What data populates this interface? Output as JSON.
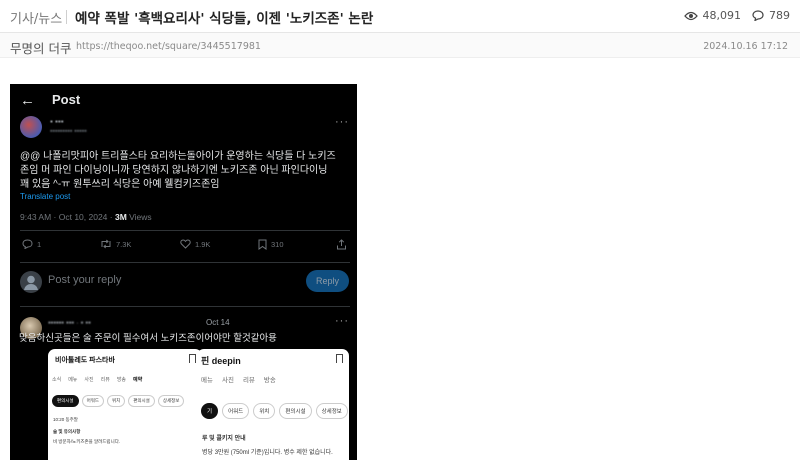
{
  "header": {
    "category": "기사/뉴스",
    "title": "예약 폭발 '흑백요리사' 식당들, 이젠 '노키즈존' 논란",
    "views": "48,091",
    "comments": "789"
  },
  "meta": {
    "author": "무명의 더쿠",
    "url": "https://theqoo.net/square/3445517981",
    "date": "2024.10.16 17:12"
  },
  "embed": {
    "back_label": "←",
    "post_title": "Post",
    "tweet_text_line1": "@@ 나폴리맛피아 트리플스타 요리하는돌아이가 운영하는 식당들 다 노키즈",
    "tweet_text_line2": "존임 머 파인 다이닝이니까 당연하지 않나하기엔 노키즈존 아닌 파인다이닝",
    "tweet_text_line3": "꽤 있음 ^-ㅠ 원투쓰리 식당은 아예 웰컴키즈존임",
    "translate": "Translate post",
    "time": "9:43 AM · Oct 10, 2024 · ",
    "views_count": "3M",
    "views_label": " Views",
    "actions": {
      "replies": "1",
      "reposts": "7.3K",
      "likes": "1.9K",
      "bookmarks": "310"
    },
    "reply_placeholder": "Post your reply",
    "reply_button": "Reply",
    "comment_date": "Oct 14",
    "comment_text": "맞음하신곳들은 술 주문이 필수여서 노키즈존이어야만 할것같아용",
    "phone1": {
      "title": "비아톨레도 파스타바",
      "tabs": [
        "소식",
        "메뉴",
        "사진",
        "리뷰",
        "방송",
        "예약"
      ],
      "chips": [
        "편의시설",
        "어워드",
        "위치",
        "편의시설",
        "상세정보"
      ],
      "line1": "10:20 동주말",
      "line2": "술 및 유의사항",
      "line3": "비 방문자/노키즈존을 알려드립니다."
    },
    "phone2": {
      "title": "핀 deepin",
      "tabs": [
        "메뉴",
        "사진",
        "리뷰",
        "방송"
      ],
      "chips": [
        "기",
        "어워드",
        "위치",
        "편의시설",
        "상세정보"
      ],
      "line1": "루 및 콜키지 안내",
      "line2": "병당 3만원 (750ml 기준)입니다. 병수 제한 없습니다."
    }
  },
  "colors": {
    "link": "#1d9bf0",
    "reply_button_bg": "#0f4e80"
  }
}
